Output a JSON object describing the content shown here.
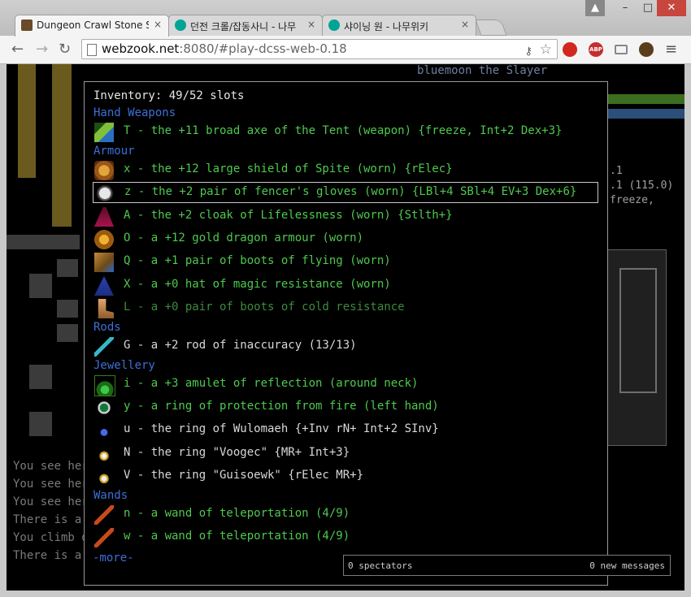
{
  "browser": {
    "tabs": [
      {
        "title": "Dungeon Crawl Stone So",
        "icon": "dcss-game-icon",
        "active": true
      },
      {
        "title": "던전 크롤/잡동사니 - 나무",
        "icon": "namuwiki-icon",
        "active": false
      },
      {
        "title": "샤이닝 원 - 나무위키",
        "icon": "namuwiki-icon",
        "active": false
      }
    ],
    "close_glyph": "×",
    "url_host": "webzook.net",
    "url_rest": ":8080/#play-dcss-web-0.18",
    "window_buttons": {
      "user": "▲",
      "min": "–",
      "max": "□",
      "close": "✕"
    },
    "nav": {
      "back": "←",
      "forward": "→",
      "reload": "↻"
    },
    "ext_abp_label": "ABP",
    "menu_glyph": "≡"
  },
  "game": {
    "player_title": "bluemoon the Slayer",
    "side_texts": [
      ".1",
      ".1 (115.0)",
      "freeze,"
    ],
    "messages": [
      "You see her",
      "You see her",
      "You see her",
      "There is a",
      "You climb d",
      "There is a"
    ]
  },
  "inventory": {
    "title": "Inventory: 49/52 slots",
    "categories": {
      "hand": "Hand Weapons",
      "armour": "Armour",
      "rods": "Rods",
      "jewellery": "Jewellery",
      "wands": "Wands"
    },
    "items": [
      {
        "text": "T - the +11 broad axe of the Tent (weapon) {freeze, Int+2 Dex+3}",
        "icon": "axe-icon"
      },
      {
        "text": "x - the +12 large shield of Spite (worn) {rElec}",
        "icon": "shield-icon"
      },
      {
        "text": "z - the +2 pair of fencer's gloves (worn) {LBl+4 SBl+4 EV+3 Dex+6}",
        "icon": "gloves-icon"
      },
      {
        "text": "A - the +2 cloak of Lifelessness (worn) {Stlth+}",
        "icon": "cloak-icon"
      },
      {
        "text": "O - a +12 gold dragon armour (worn)",
        "icon": "dragon-armour-icon"
      },
      {
        "text": "Q - a +1 pair of boots of flying (worn)",
        "icon": "boots-icon"
      },
      {
        "text": "X - a +0 hat of magic resistance (worn)",
        "icon": "hat-icon"
      },
      {
        "text": "L - a +0 pair of boots of cold resistance",
        "icon": "boots-icon"
      },
      {
        "text": "G - a +2 rod of inaccuracy (13/13)",
        "icon": "rod-icon"
      },
      {
        "text": "i - a +3 amulet of reflection (around neck)",
        "icon": "amulet-icon"
      },
      {
        "text": "y - a ring of protection from fire (left hand)",
        "icon": "ring-icon"
      },
      {
        "text": "u - the ring of Wulomaeh {+Inv rN+ Int+2 SInv}",
        "icon": "ring-icon"
      },
      {
        "text": "N - the ring \"Voogec\" {MR+ Int+3}",
        "icon": "ring-icon"
      },
      {
        "text": "V - the ring \"Guisoewk\" {rElec MR+}",
        "icon": "ring-icon"
      },
      {
        "text": "n - a wand of teleportation (4/9)",
        "icon": "wand-icon"
      },
      {
        "text": "w - a wand of teleportation (4/9)",
        "icon": "wand-icon"
      }
    ],
    "more": "-more-"
  },
  "status": {
    "spectators": "0 spectators",
    "new_messages": "0 new messages"
  },
  "colors": {
    "worn_green": "#4ec94e",
    "dim_green": "#3c8a3c",
    "category_blue": "#3f6fd8"
  }
}
